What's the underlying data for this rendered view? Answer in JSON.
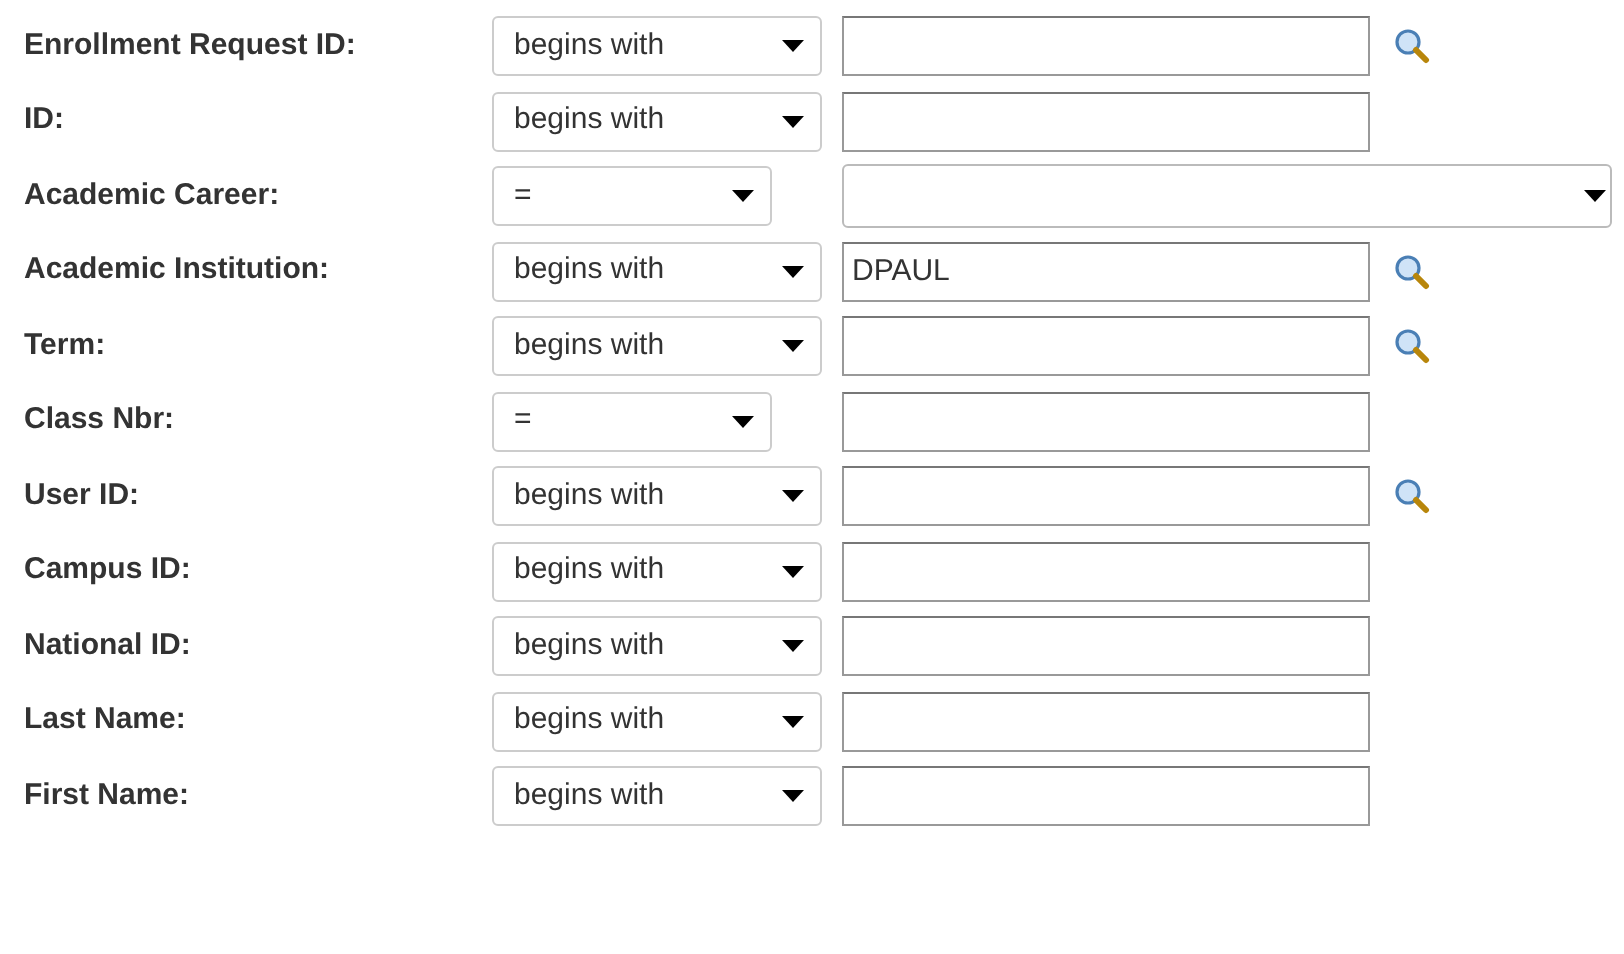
{
  "fields": [
    {
      "label": "Enrollment Request ID:",
      "operator": "begins with",
      "kind": "text",
      "lookup": true
    },
    {
      "label": "ID:",
      "operator": "begins with",
      "kind": "text",
      "lookup": false
    },
    {
      "label": "Academic Career:",
      "operator": "=",
      "kind": "select"
    },
    {
      "label": "Academic Institution:",
      "operator": "begins with",
      "kind": "text",
      "value": "DPAUL",
      "lookup": true
    },
    {
      "label": "Term:",
      "operator": "begins with",
      "kind": "text",
      "lookup": true
    },
    {
      "label": "Class Nbr:",
      "operator": "=",
      "kind": "text",
      "lookup": false
    },
    {
      "label": "User ID:",
      "operator": "begins with",
      "kind": "text",
      "lookup": true
    },
    {
      "label": "Campus ID:",
      "operator": "begins with",
      "kind": "text",
      "lookup": false
    },
    {
      "label": "National ID:",
      "operator": "begins with",
      "kind": "text",
      "lookup": false
    },
    {
      "label": "Last Name:",
      "operator": "begins with",
      "kind": "text",
      "lookup": false
    },
    {
      "label": "First Name:",
      "operator": "begins with",
      "kind": "text",
      "lookup": false
    }
  ]
}
